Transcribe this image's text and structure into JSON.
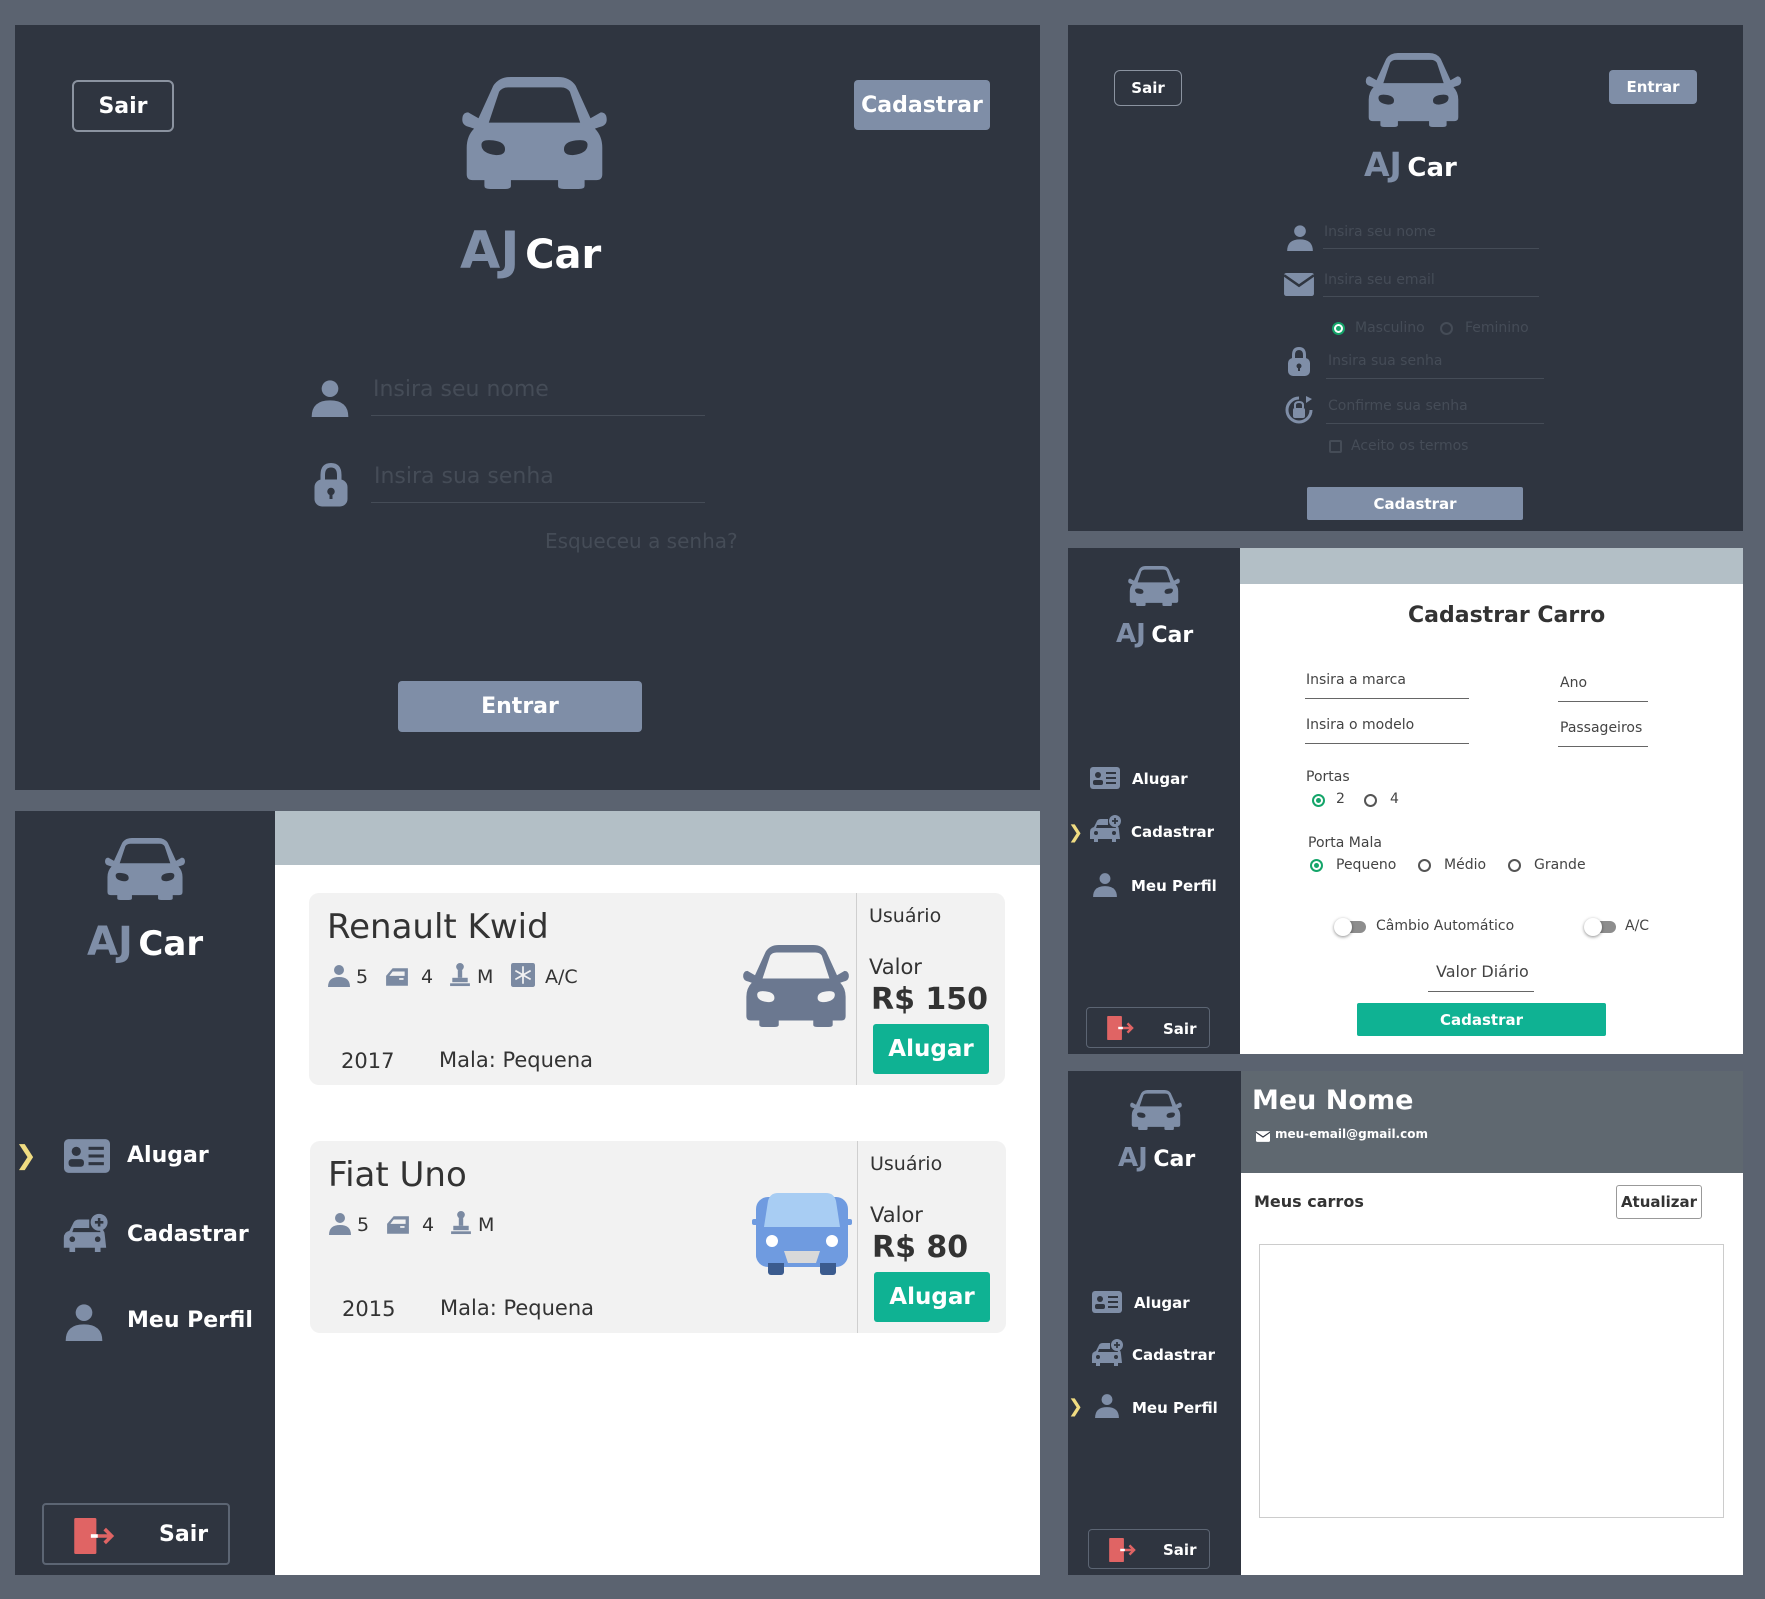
{
  "brand": {
    "aj": "AJ",
    "car": "Car"
  },
  "login": {
    "sair": "Sair",
    "cadastrar": "Cadastrar",
    "name_placeholder": "Insira seu nome",
    "password_placeholder": "Insira sua senha",
    "forgot": "Esqueceu a senha?",
    "entrar": "Entrar"
  },
  "register": {
    "sair": "Sair",
    "entrar": "Entrar",
    "name_placeholder": "Insira seu nome",
    "email_placeholder": "Insira seu email",
    "gender_male": "Masculino",
    "gender_female": "Feminino",
    "password_placeholder": "Insira sua senha",
    "confirm_placeholder": "Confirme sua senha",
    "terms": "Aceito os termos",
    "submit": "Cadastrar"
  },
  "nav": {
    "alugar": "Alugar",
    "cadastrar": "Cadastrar",
    "perfil": "Meu Perfil",
    "sair": "Sair",
    "chevron": "❯"
  },
  "cars": [
    {
      "name": "Renault Kwid",
      "seats": "5",
      "doors": "4",
      "size": "M",
      "ac": "A/C",
      "year": "2017",
      "luggage": "Mala: Pequena",
      "owner": "Usuário",
      "value_label": "Valor",
      "price": "R$ 150",
      "rent": "Alugar",
      "icon_color": "#6b7890"
    },
    {
      "name": "Fiat Uno",
      "seats": "5",
      "doors": "4",
      "size": "M",
      "year": "2015",
      "luggage": "Mala: Pequena",
      "owner": "Usuário",
      "value_label": "Valor",
      "price": "R$ 80",
      "rent": "Alugar",
      "icon_color": "#6f9be0"
    }
  ],
  "car_form": {
    "title": "Cadastrar Carro",
    "brand_placeholder": "Insira a marca",
    "year_placeholder": "Ano",
    "model_placeholder": "Insira o modelo",
    "passengers_placeholder": "Passageiros",
    "doors_label": "Portas",
    "doors_options": [
      "2",
      "4"
    ],
    "luggage_label": "Porta Mala",
    "luggage_options": [
      "Pequeno",
      "Médio",
      "Grande"
    ],
    "auto_label": "Câmbio Automático",
    "ac_label": "A/C",
    "daily_placeholder": "Valor Diário",
    "submit": "Cadastrar"
  },
  "profile": {
    "name": "Meu Nome",
    "email": "meu-email@gmail.com",
    "my_cars": "Meus carros",
    "refresh": "Atualizar"
  },
  "colors": {
    "accent": "#7f8ea7",
    "green": "#0fb293",
    "dark": "#2f3540",
    "sair_icon": "#e06464"
  }
}
